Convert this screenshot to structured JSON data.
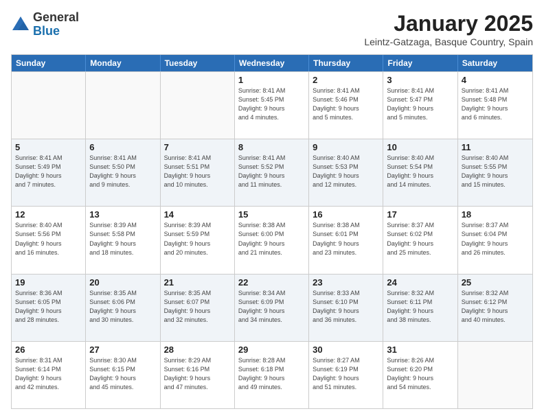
{
  "logo": {
    "general": "General",
    "blue": "Blue"
  },
  "title": "January 2025",
  "subtitle": "Leintz-Gatzaga, Basque Country, Spain",
  "header_days": [
    "Sunday",
    "Monday",
    "Tuesday",
    "Wednesday",
    "Thursday",
    "Friday",
    "Saturday"
  ],
  "weeks": [
    [
      {
        "day": "",
        "info": ""
      },
      {
        "day": "",
        "info": ""
      },
      {
        "day": "",
        "info": ""
      },
      {
        "day": "1",
        "info": "Sunrise: 8:41 AM\nSunset: 5:45 PM\nDaylight: 9 hours\nand 4 minutes."
      },
      {
        "day": "2",
        "info": "Sunrise: 8:41 AM\nSunset: 5:46 PM\nDaylight: 9 hours\nand 5 minutes."
      },
      {
        "day": "3",
        "info": "Sunrise: 8:41 AM\nSunset: 5:47 PM\nDaylight: 9 hours\nand 5 minutes."
      },
      {
        "day": "4",
        "info": "Sunrise: 8:41 AM\nSunset: 5:48 PM\nDaylight: 9 hours\nand 6 minutes."
      }
    ],
    [
      {
        "day": "5",
        "info": "Sunrise: 8:41 AM\nSunset: 5:49 PM\nDaylight: 9 hours\nand 7 minutes."
      },
      {
        "day": "6",
        "info": "Sunrise: 8:41 AM\nSunset: 5:50 PM\nDaylight: 9 hours\nand 9 minutes."
      },
      {
        "day": "7",
        "info": "Sunrise: 8:41 AM\nSunset: 5:51 PM\nDaylight: 9 hours\nand 10 minutes."
      },
      {
        "day": "8",
        "info": "Sunrise: 8:41 AM\nSunset: 5:52 PM\nDaylight: 9 hours\nand 11 minutes."
      },
      {
        "day": "9",
        "info": "Sunrise: 8:40 AM\nSunset: 5:53 PM\nDaylight: 9 hours\nand 12 minutes."
      },
      {
        "day": "10",
        "info": "Sunrise: 8:40 AM\nSunset: 5:54 PM\nDaylight: 9 hours\nand 14 minutes."
      },
      {
        "day": "11",
        "info": "Sunrise: 8:40 AM\nSunset: 5:55 PM\nDaylight: 9 hours\nand 15 minutes."
      }
    ],
    [
      {
        "day": "12",
        "info": "Sunrise: 8:40 AM\nSunset: 5:56 PM\nDaylight: 9 hours\nand 16 minutes."
      },
      {
        "day": "13",
        "info": "Sunrise: 8:39 AM\nSunset: 5:58 PM\nDaylight: 9 hours\nand 18 minutes."
      },
      {
        "day": "14",
        "info": "Sunrise: 8:39 AM\nSunset: 5:59 PM\nDaylight: 9 hours\nand 20 minutes."
      },
      {
        "day": "15",
        "info": "Sunrise: 8:38 AM\nSunset: 6:00 PM\nDaylight: 9 hours\nand 21 minutes."
      },
      {
        "day": "16",
        "info": "Sunrise: 8:38 AM\nSunset: 6:01 PM\nDaylight: 9 hours\nand 23 minutes."
      },
      {
        "day": "17",
        "info": "Sunrise: 8:37 AM\nSunset: 6:02 PM\nDaylight: 9 hours\nand 25 minutes."
      },
      {
        "day": "18",
        "info": "Sunrise: 8:37 AM\nSunset: 6:04 PM\nDaylight: 9 hours\nand 26 minutes."
      }
    ],
    [
      {
        "day": "19",
        "info": "Sunrise: 8:36 AM\nSunset: 6:05 PM\nDaylight: 9 hours\nand 28 minutes."
      },
      {
        "day": "20",
        "info": "Sunrise: 8:35 AM\nSunset: 6:06 PM\nDaylight: 9 hours\nand 30 minutes."
      },
      {
        "day": "21",
        "info": "Sunrise: 8:35 AM\nSunset: 6:07 PM\nDaylight: 9 hours\nand 32 minutes."
      },
      {
        "day": "22",
        "info": "Sunrise: 8:34 AM\nSunset: 6:09 PM\nDaylight: 9 hours\nand 34 minutes."
      },
      {
        "day": "23",
        "info": "Sunrise: 8:33 AM\nSunset: 6:10 PM\nDaylight: 9 hours\nand 36 minutes."
      },
      {
        "day": "24",
        "info": "Sunrise: 8:32 AM\nSunset: 6:11 PM\nDaylight: 9 hours\nand 38 minutes."
      },
      {
        "day": "25",
        "info": "Sunrise: 8:32 AM\nSunset: 6:12 PM\nDaylight: 9 hours\nand 40 minutes."
      }
    ],
    [
      {
        "day": "26",
        "info": "Sunrise: 8:31 AM\nSunset: 6:14 PM\nDaylight: 9 hours\nand 42 minutes."
      },
      {
        "day": "27",
        "info": "Sunrise: 8:30 AM\nSunset: 6:15 PM\nDaylight: 9 hours\nand 45 minutes."
      },
      {
        "day": "28",
        "info": "Sunrise: 8:29 AM\nSunset: 6:16 PM\nDaylight: 9 hours\nand 47 minutes."
      },
      {
        "day": "29",
        "info": "Sunrise: 8:28 AM\nSunset: 6:18 PM\nDaylight: 9 hours\nand 49 minutes."
      },
      {
        "day": "30",
        "info": "Sunrise: 8:27 AM\nSunset: 6:19 PM\nDaylight: 9 hours\nand 51 minutes."
      },
      {
        "day": "31",
        "info": "Sunrise: 8:26 AM\nSunset: 6:20 PM\nDaylight: 9 hours\nand 54 minutes."
      },
      {
        "day": "",
        "info": ""
      }
    ]
  ]
}
